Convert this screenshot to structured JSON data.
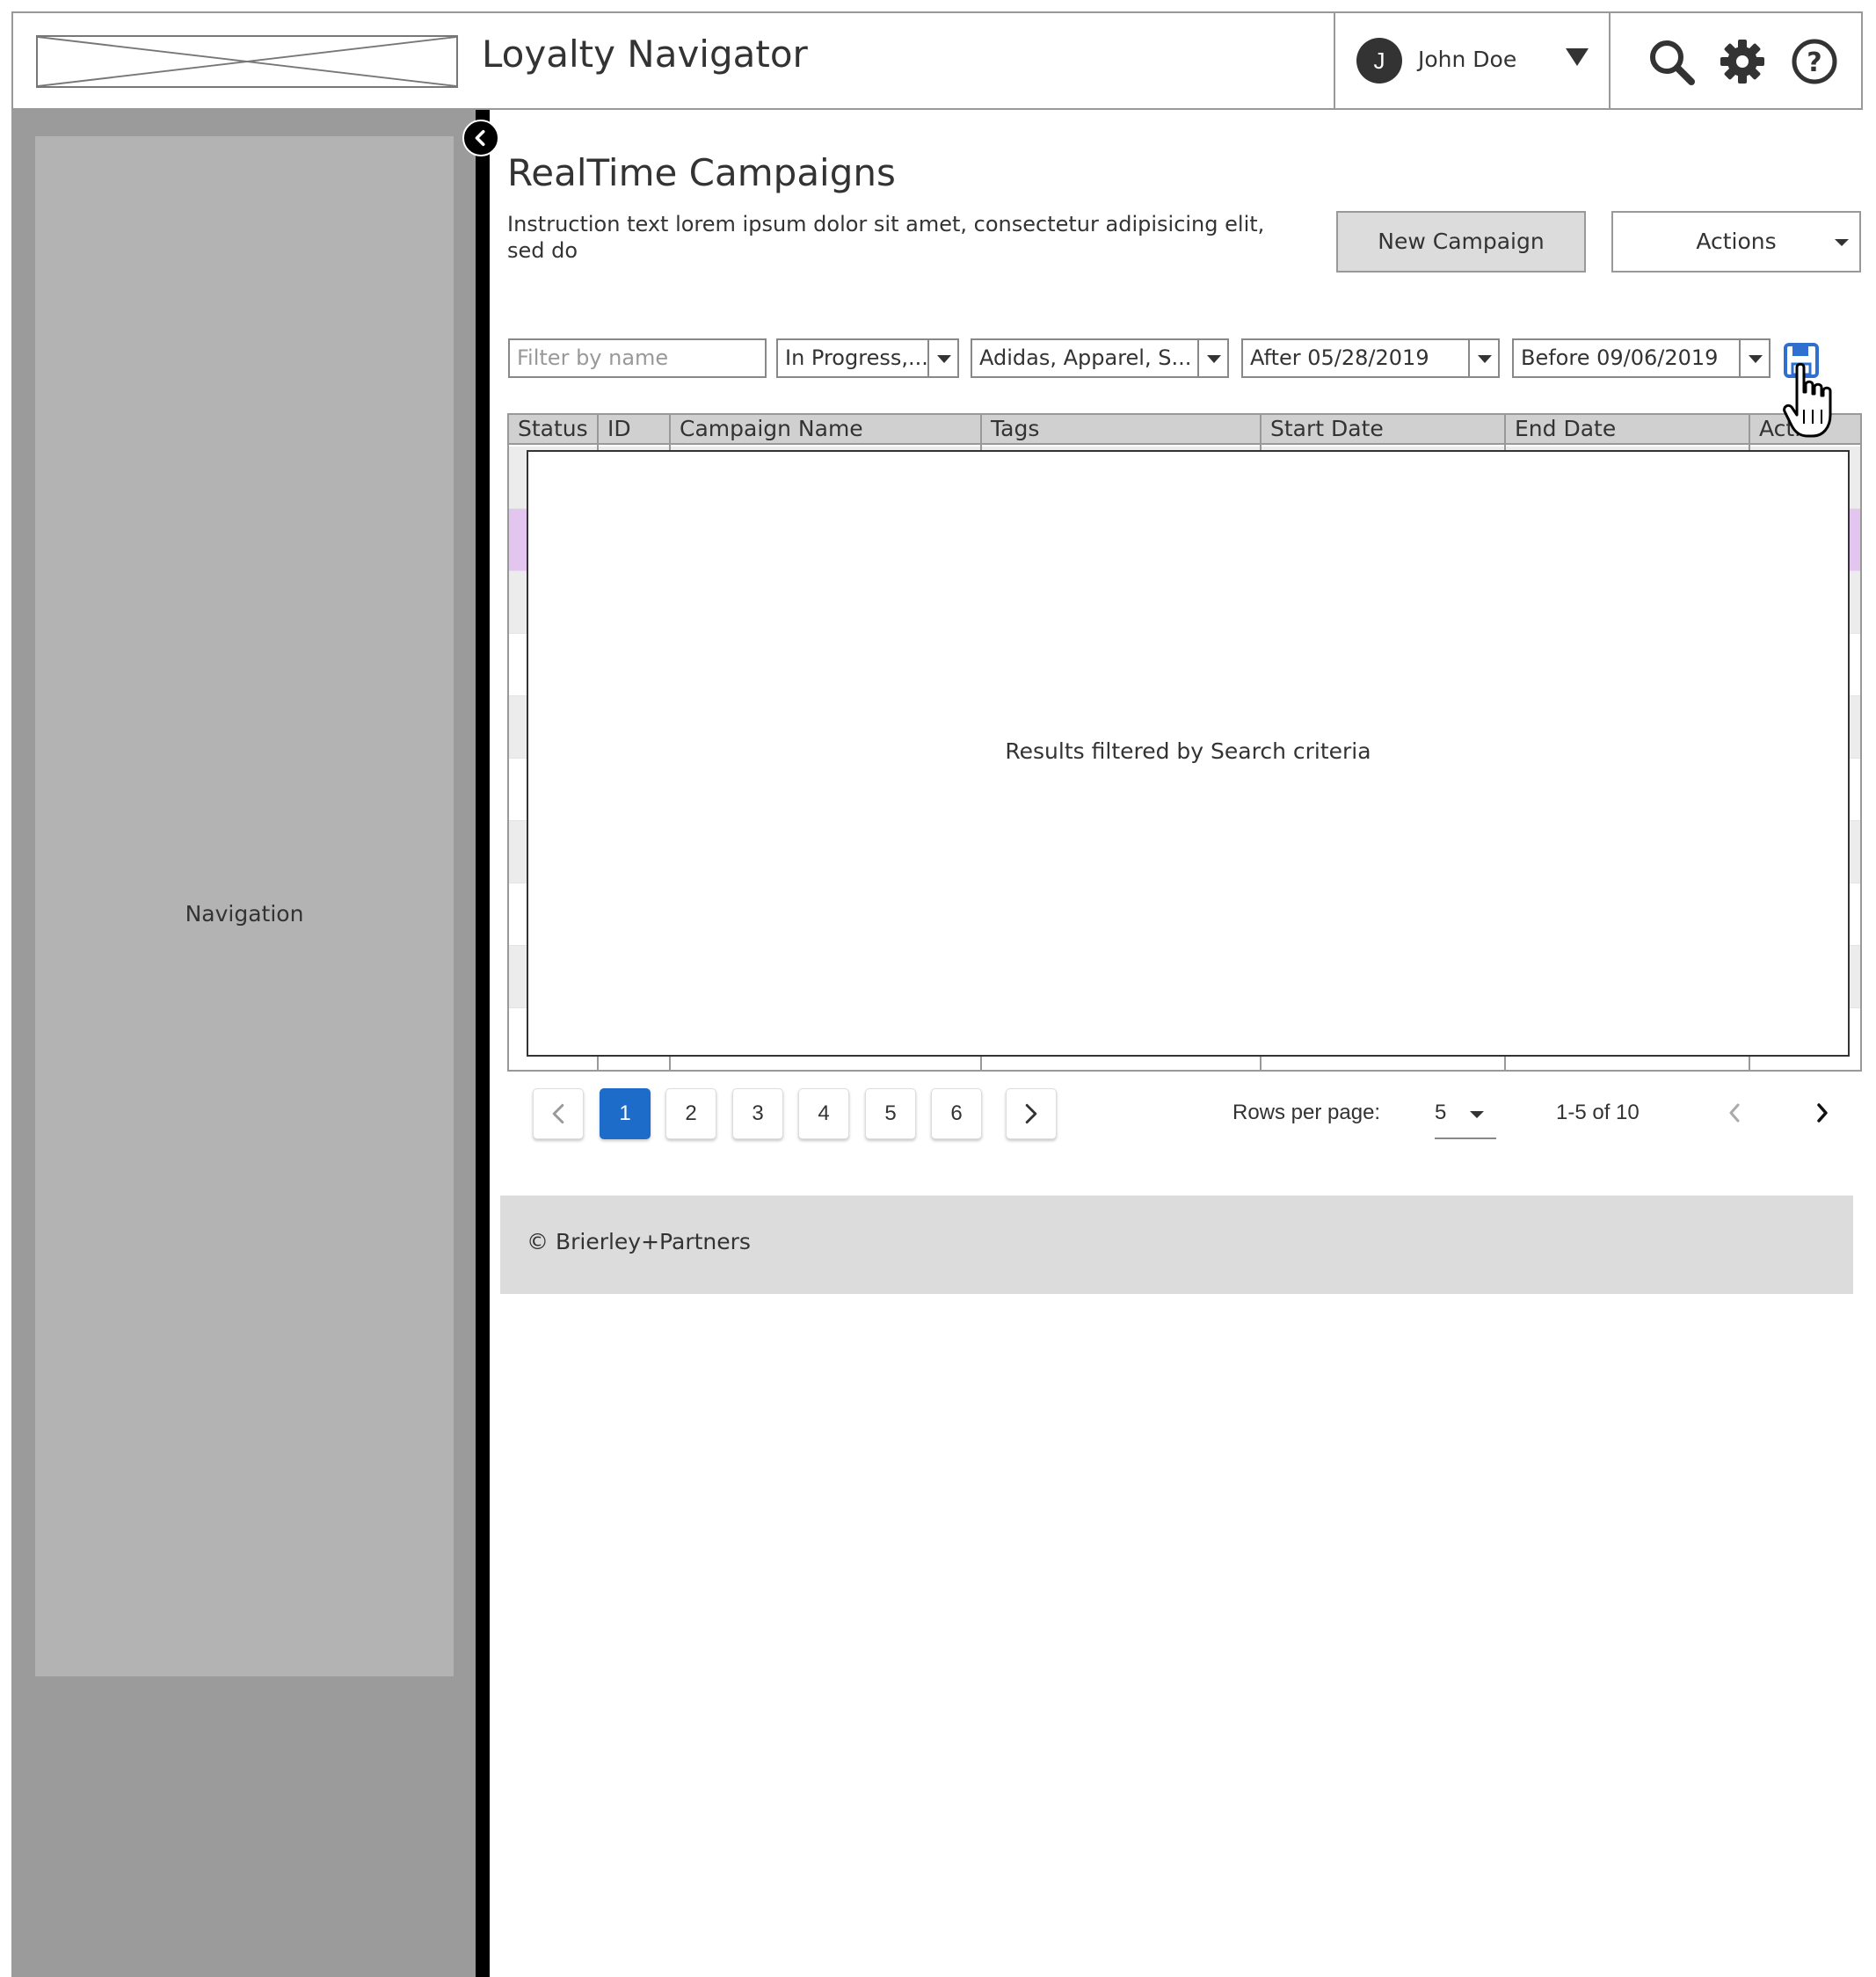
{
  "header": {
    "app_title": "Loyalty Navigator",
    "user": {
      "initial": "J",
      "name": "John Doe"
    }
  },
  "sidebar": {
    "label": "Navigation"
  },
  "page": {
    "title": "RealTime Campaigns",
    "instruction": "Instruction text lorem ipsum dolor sit amet, consectetur adipisicing elit, sed do",
    "new_campaign_label": "New Campaign",
    "actions_label": "Actions"
  },
  "filters": {
    "name_placeholder": "Filter by name",
    "status": "In Progress,...",
    "tags": "Adidas, Apparel, S...",
    "after": "After 05/28/2019",
    "before": "Before 09/06/2019"
  },
  "table": {
    "columns": [
      "Status",
      "ID",
      "Campaign Name",
      "Tags",
      "Start Date",
      "End Date",
      "Acti"
    ],
    "overlay_text": "Results filtered by Search criteria"
  },
  "pagination": {
    "pages": [
      "1",
      "2",
      "3",
      "4",
      "5",
      "6"
    ],
    "current_page": "1",
    "rows_label": "Rows per page:",
    "rows_value": "5",
    "range": "1-5 of 10"
  },
  "footer": {
    "text": "© Brierley+Partners"
  },
  "colors": {
    "accent": "#1d6cc9",
    "row_highlight": "#e2c6f0",
    "sidebar": "#9b9b9b",
    "sidebar_panel": "#b3b3b3",
    "footer": "#dcdcdc"
  },
  "icons": [
    "logo-placeholder-icon",
    "chevron-down-icon",
    "search-icon",
    "gear-icon",
    "help-icon",
    "collapse-chevron-icon",
    "save-icon",
    "hand-cursor-icon",
    "chevron-left-icon",
    "chevron-right-icon"
  ]
}
